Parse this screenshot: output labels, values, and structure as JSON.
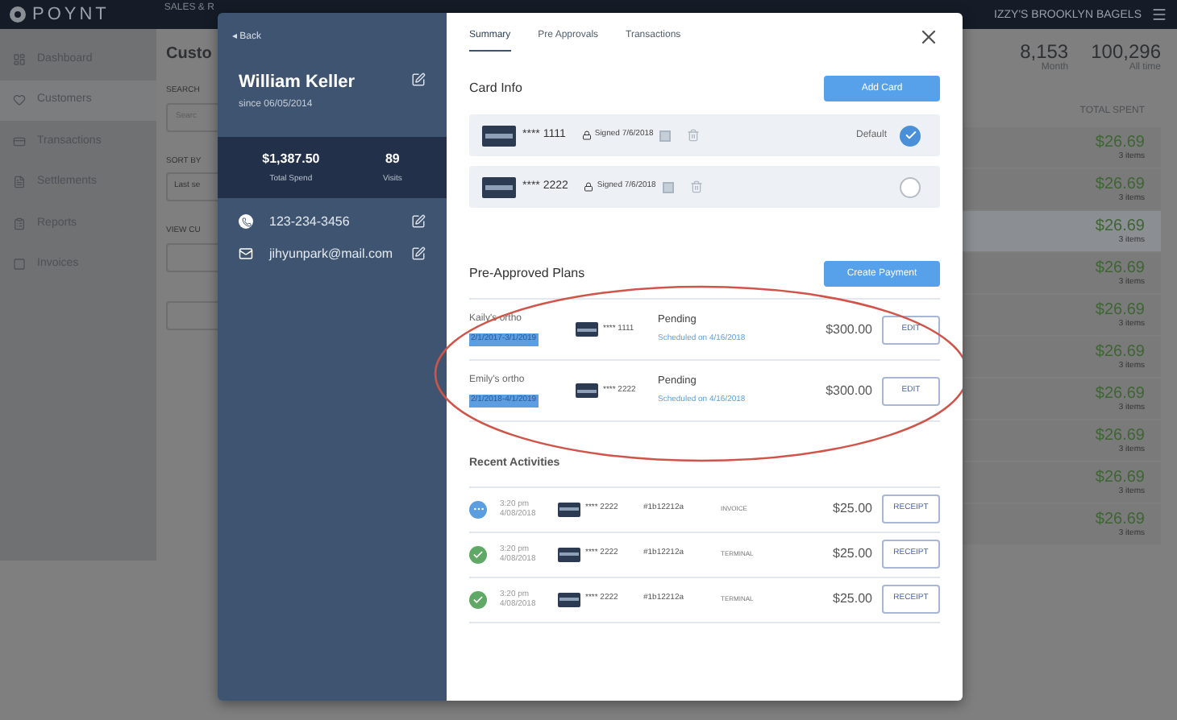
{
  "header": {
    "logo": "POYNT",
    "nav_item": "SALES & R",
    "business": "IZZY'S BROOKLYN BAGELS"
  },
  "sidebar": {
    "items": [
      {
        "label": "Dashboard",
        "selected": false
      },
      {
        "label": "Customers",
        "selected": true
      },
      {
        "label": "Transactions",
        "selected": false
      },
      {
        "label": "Settlements",
        "selected": false
      },
      {
        "label": "Reports",
        "selected": false
      },
      {
        "label": "Invoices",
        "selected": false
      }
    ]
  },
  "page": {
    "title": "Custo",
    "search_label": "SEARCH",
    "search_placeholder": "Searc",
    "sort_label": "SORT BY",
    "sort_value": "Last se",
    "view_label": "VIEW CU",
    "stats": [
      {
        "value": "8,153",
        "label": "Month"
      },
      {
        "value": "100,296",
        "label": "All time"
      }
    ],
    "column": "TOTAL SPENT",
    "rows": [
      {
        "amount": "$26.69",
        "items": "3 items",
        "selected": false
      },
      {
        "amount": "$26.69",
        "items": "3 items",
        "selected": false
      },
      {
        "amount": "$26.69",
        "items": "3 items",
        "selected": true
      },
      {
        "amount": "$26.69",
        "items": "3 items",
        "selected": false
      },
      {
        "amount": "$26.69",
        "items": "3 items",
        "selected": false
      },
      {
        "amount": "$26.69",
        "items": "3 items",
        "selected": false
      },
      {
        "amount": "$26.69",
        "items": "3 items",
        "selected": false
      },
      {
        "amount": "$26.69",
        "items": "3 items",
        "selected": false
      },
      {
        "amount": "$26.69",
        "items": "3 items",
        "selected": false
      },
      {
        "amount": "$26.69",
        "items": "3 items",
        "selected": false
      }
    ]
  },
  "customer": {
    "back": "◂ Back",
    "name": "William Keller",
    "since": "since 06/05/2014",
    "stats": [
      {
        "value": "$1,387.50",
        "label": "Total Spend"
      },
      {
        "value": "89",
        "label": "Visits"
      }
    ],
    "contacts": [
      {
        "kind": "phone",
        "value": "123-234-3456"
      },
      {
        "kind": "email",
        "value": "jihyunpark@mail.com"
      }
    ]
  },
  "tabs": [
    {
      "label": "Summary",
      "selected": true
    },
    {
      "label": "Pre Approvals",
      "selected": false
    },
    {
      "label": "Transactions",
      "selected": false
    }
  ],
  "card_info": {
    "title": "Card Info",
    "button": "Add Card",
    "cards": [
      {
        "number": "**** 1111",
        "signed": "Signed 7/6/2018",
        "default_label": "Default",
        "selected": true
      },
      {
        "number": "**** 2222",
        "signed": "Signed 7/6/2018",
        "selected": false
      }
    ]
  },
  "plans": {
    "title": "Pre-Approved Plans",
    "button": "Create Payment",
    "rows": [
      {
        "name": "Kaily's ortho",
        "period": "2/1/2017-3/1/2019",
        "card": "**** 1111",
        "status": "Pending",
        "scheduled": "Scheduled on 4/16/2018",
        "amount": "$300.00",
        "button": "EDIT"
      },
      {
        "name": "Emily's ortho",
        "period": "2/1/2018-4/1/2019",
        "card": "**** 2222",
        "status": "Pending",
        "scheduled": "Scheduled on 4/16/2018",
        "amount": "$300.00",
        "button": "EDIT"
      }
    ]
  },
  "activities": {
    "title": "Recent Activities",
    "rows": [
      {
        "kind": "pending",
        "time": "3:20 pm",
        "date": "4/08/2018",
        "card": "**** 2222",
        "id": "#1b12212a",
        "channel": "INVOICE",
        "amount": "$25.00",
        "button": "RECEIPT"
      },
      {
        "kind": "complete",
        "time": "3:20 pm",
        "date": "4/08/2018",
        "card": "**** 2222",
        "id": "#1b12212a",
        "channel": "TERMINAL",
        "amount": "$25.00",
        "button": "RECEIPT"
      },
      {
        "kind": "complete",
        "time": "3:20 pm",
        "date": "4/08/2018",
        "card": "**** 2222",
        "id": "#1b12212a",
        "channel": "TERMINAL",
        "amount": "$25.00",
        "button": "RECEIPT"
      }
    ]
  }
}
